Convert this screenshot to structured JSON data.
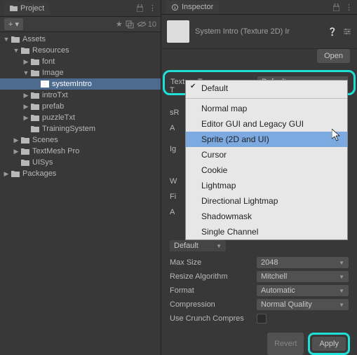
{
  "project": {
    "tabName": "Project",
    "addLabel": "+",
    "filterCount": "10",
    "tree": {
      "assets": "Assets",
      "resources": "Resources",
      "font": "font",
      "image": "Image",
      "systemIntro": "systemIntro",
      "introTxt": "introTxt",
      "prefab": "prefab",
      "puzzleTxt": "puzzleTxt",
      "trainingSystem": "TrainingSystem",
      "scenes": "Scenes",
      "textmesh": "TextMesh Pro",
      "uisys": "UISys",
      "packages": "Packages"
    }
  },
  "inspector": {
    "tabName": "Inspector",
    "title": "System Intro (Texture 2D) Ir",
    "openLabel": "Open",
    "textureTypeLabel": "Texture Type",
    "textureTypeValue": "Default",
    "partialT": "T",
    "partialSR": "sR",
    "partialA": "A",
    "partialIg": "Ig",
    "partialW": "W",
    "partialFi": "Fi",
    "partialA2": "A",
    "defaultTab": "Default",
    "maxSizeLabel": "Max Size",
    "maxSizeValue": "2048",
    "resizeAlgLabel": "Resize Algorithm",
    "resizeAlgValue": "Mitchell",
    "formatLabel": "Format",
    "formatValue": "Automatic",
    "compressionLabel": "Compression",
    "compressionValue": "Normal Quality",
    "crunchLabel": "Use Crunch Compres",
    "revertLabel": "Revert",
    "applyLabel": "Apply"
  },
  "menu": {
    "items": {
      "default": "Default",
      "normalMap": "Normal map",
      "editorGui": "Editor GUI and Legacy GUI",
      "sprite": "Sprite (2D and UI)",
      "cursor": "Cursor",
      "cookie": "Cookie",
      "lightmap": "Lightmap",
      "dirLightmap": "Directional Lightmap",
      "shadowmask": "Shadowmask",
      "single": "Single Channel"
    }
  }
}
